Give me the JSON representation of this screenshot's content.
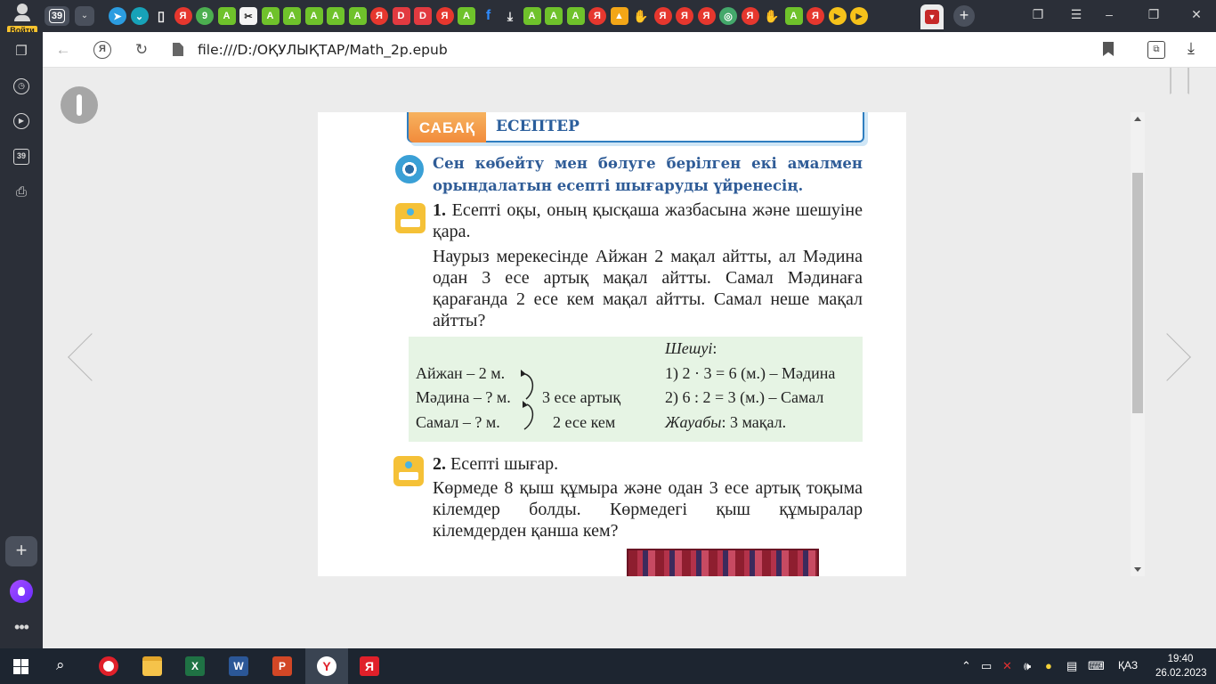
{
  "browser": {
    "login_label": "Войти",
    "tab_count": "39",
    "tab_favicons": [
      "telegram",
      "ya-disk",
      "doc",
      "yandex",
      "whatsapp",
      "antiplagiat",
      "capcut",
      "antiplagiat",
      "antiplagiat",
      "antiplagiat",
      "antiplagiat",
      "antiplagiat",
      "yandex",
      "dzen",
      "dzen",
      "yandex",
      "antiplagiat",
      "facebook",
      "download",
      "antiplagiat",
      "antiplagiat",
      "antiplagiat",
      "yandex",
      "picture",
      "hand",
      "yandex",
      "yandex",
      "yandex",
      "globe",
      "yandex",
      "hand",
      "antiplagiat",
      "yandex",
      "play",
      "play"
    ],
    "address_url": "file:///D:/ОҚУЛЫҚТАР/Math_2p.epub"
  },
  "page": {
    "lesson_label": "САБАҚ",
    "lesson_title": "ЕСЕПТЕР",
    "goal": "Сен көбейту мен бөлуге берілген екі амалмен орындалатын есепті шығаруды үйренесің.",
    "task1_number": "1.",
    "task1_title": "Есепті оқы, оның қысқаша жазбасына және шешуіне қара.",
    "task1_body": "Наурыз мерекесінде Айжан 2 мақал айтты, ал Мәдина одан 3 есе артық мақал айтты. Самал Мәдинаға қарағанда 2 есе кем мақал айтты. Самал неше мақал айтты?",
    "solution": {
      "left_line1": "Айжан – 2 м.",
      "left_line2": "Мәдина – ? м.",
      "left_line3": "Самал – ? м.",
      "rel1": "3 есе артық",
      "rel2": "2 есе кем",
      "heading": "Шешуі",
      "heading_colon": ":",
      "step1": "1) 2 · 3 = 6 (м.) – Мәдина",
      "step2": "2) 6 : 2 = 3 (м.) – Самал",
      "answer_label": "Жауабы",
      "answer_value": ": 3 мақал."
    },
    "task2_number": "2.",
    "task2_title": "Есепті шығар.",
    "task2_body": "Көрмеде 8 қыш құмыра және одан 3 есе артық тоқыма кілемдер болды. Көрмедегі қыш құмыралар кілемдерден қанша кем?"
  },
  "taskbar": {
    "lang": "ҚАЗ",
    "time": "19:40",
    "date": "26.02.2023"
  }
}
